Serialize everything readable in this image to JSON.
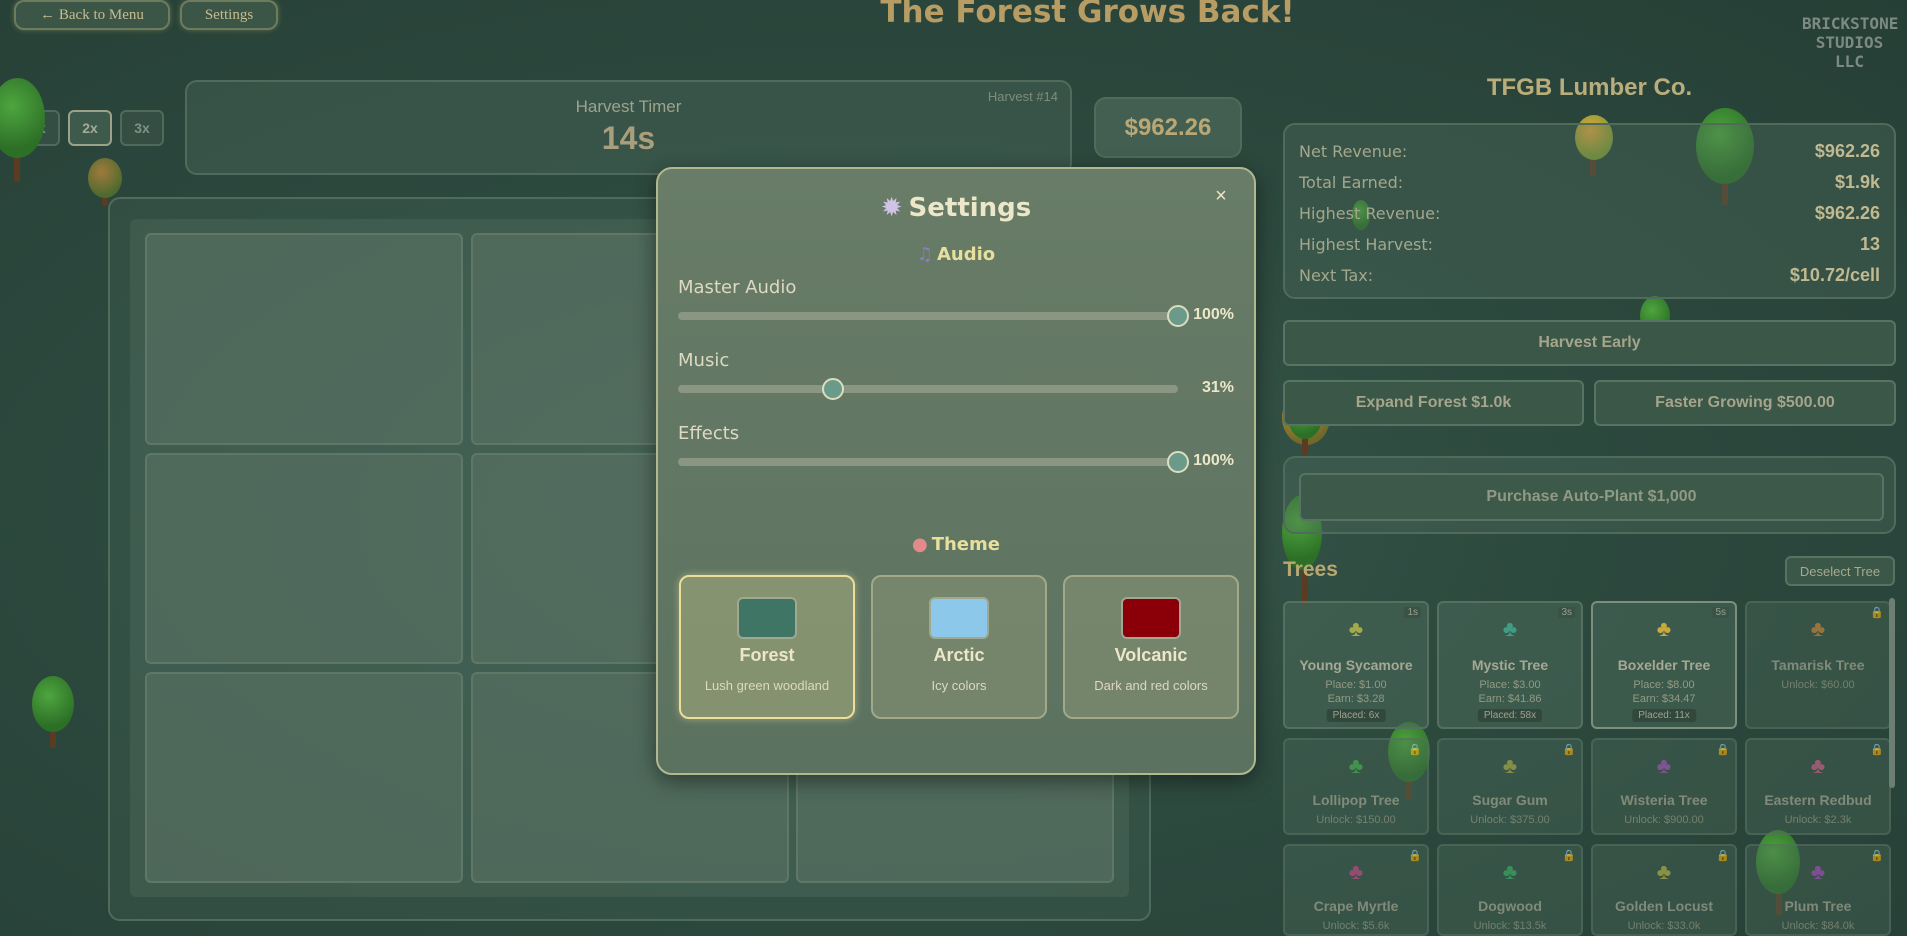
{
  "header": {
    "back_label": "← Back to Menu",
    "settings_label": "Settings",
    "title": "The Forest Grows Back!",
    "studio_logo": "BRICKSTONE STUDIOS LLC"
  },
  "speed": {
    "options": [
      "1x",
      "2x",
      "3x"
    ],
    "selected": "2x"
  },
  "harvest": {
    "timer_label": "Harvest Timer",
    "timer_value": "14s",
    "harvest_number": "Harvest #14",
    "balance": "$962.26"
  },
  "company": {
    "name": "TFGB Lumber Co.",
    "stats": [
      {
        "label": "Net Revenue:",
        "value": "$962.26"
      },
      {
        "label": "Total Earned:",
        "value": "$1.9k"
      },
      {
        "label": "Highest Revenue:",
        "value": "$962.26"
      },
      {
        "label": "Highest Harvest:",
        "value": "13"
      },
      {
        "label": "Next Tax:",
        "value": "$10.72/cell"
      }
    ]
  },
  "actions": {
    "harvest_early": "Harvest Early",
    "expand_forest": "Expand Forest $1.0k",
    "faster_growing": "Faster Growing $500.00",
    "auto_plant": "Purchase Auto-Plant $1,000"
  },
  "trees_section": {
    "title": "Trees",
    "deselect_label": "Deselect Tree",
    "cards": [
      {
        "name": "Young Sycamore",
        "place": "Place: $1.00",
        "earn": "Earn: $3.28",
        "placed": "Placed: 6x",
        "time": "1s",
        "locked": false,
        "icon": "🌳"
      },
      {
        "name": "Mystic Tree",
        "place": "Place: $3.00",
        "earn": "Earn: $41.86",
        "placed": "Placed: 58x",
        "time": "3s",
        "locked": false,
        "icon": "🌳"
      },
      {
        "name": "Boxelder Tree",
        "place": "Place: $8.00",
        "earn": "Earn: $34.47",
        "placed": "Placed: 11x",
        "time": "5s",
        "locked": false,
        "icon": "🌳"
      },
      {
        "name": "Tamarisk Tree",
        "unlock": "Unlock: $60.00",
        "locked": true,
        "icon": "🌳"
      },
      {
        "name": "Lollipop Tree",
        "unlock": "Unlock: $150.00",
        "locked": true,
        "icon": "🌳"
      },
      {
        "name": "Sugar Gum",
        "unlock": "Unlock: $375.00",
        "locked": true,
        "icon": "🌳"
      },
      {
        "name": "Wisteria Tree",
        "unlock": "Unlock: $900.00",
        "locked": true,
        "icon": "🌳"
      },
      {
        "name": "Eastern Redbud",
        "unlock": "Unlock: $2.3k",
        "locked": true,
        "icon": "🌳"
      },
      {
        "name": "Crape Myrtle",
        "unlock": "Unlock: $5.6k",
        "locked": true,
        "icon": "🌳"
      },
      {
        "name": "Dogwood",
        "unlock": "Unlock: $13.5k",
        "locked": true,
        "icon": "🌳"
      },
      {
        "name": "Golden Locust",
        "unlock": "Unlock: $33.0k",
        "locked": true,
        "icon": "🌳"
      },
      {
        "name": "Plum Tree",
        "unlock": "Unlock: $84.0k",
        "locked": true,
        "icon": "🌳"
      }
    ]
  },
  "settings_modal": {
    "title": "Settings",
    "title_icon": "gear-icon",
    "close_label": "×",
    "audio_title": "Audio",
    "sliders": [
      {
        "label": "Master Audio",
        "value": 100,
        "display": "100%"
      },
      {
        "label": "Music",
        "value": 31,
        "display": "31%"
      },
      {
        "label": "Effects",
        "value": 100,
        "display": "100%"
      }
    ],
    "theme_title": "Theme",
    "themes": [
      {
        "name": "Forest",
        "desc": "Lush green woodland",
        "color": "#3f7565",
        "selected": true
      },
      {
        "name": "Arctic",
        "desc": "Icy colors",
        "color": "#8cc8ea",
        "selected": false
      },
      {
        "name": "Volcanic",
        "desc": "Dark and red colors",
        "color": "#8b0008",
        "selected": false
      }
    ]
  },
  "colors": {
    "accent_gold": "#e7df9e",
    "title_brown": "#b79d63",
    "background": "#2d4a3f"
  }
}
